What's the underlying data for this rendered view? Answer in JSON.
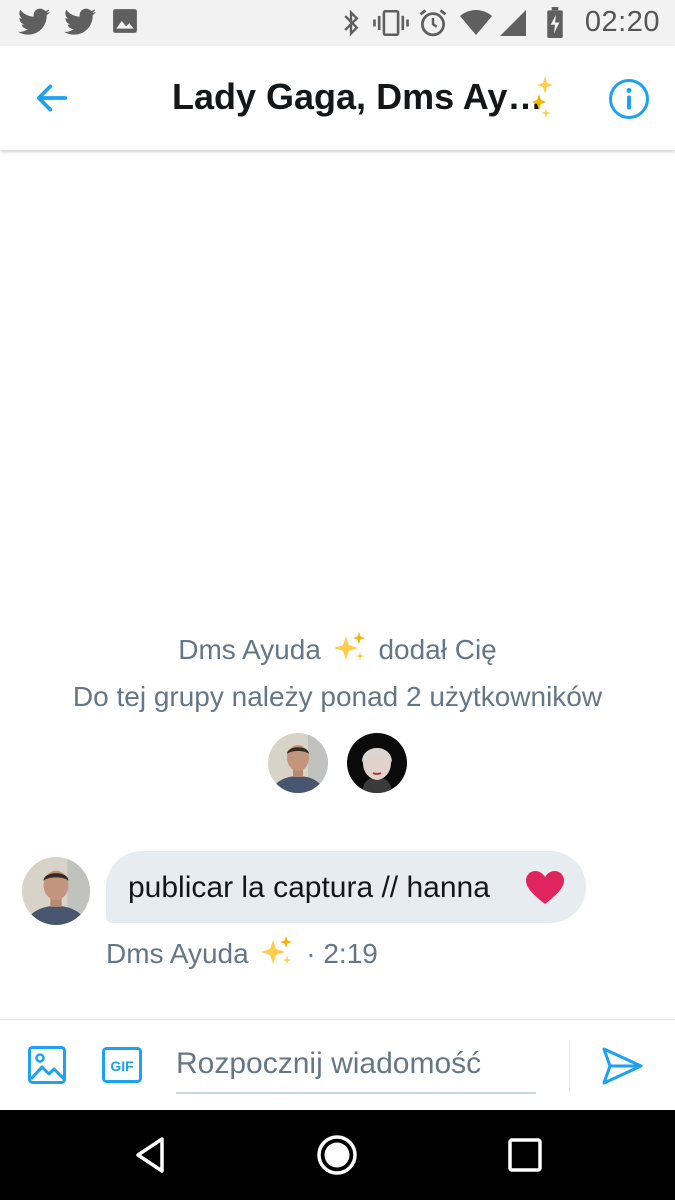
{
  "status_bar": {
    "time": "02:20",
    "left_icons": [
      "twitter-notification-icon",
      "twitter-notification-icon",
      "image-notification-icon"
    ],
    "right_icons": [
      "bluetooth-icon",
      "vibrate-icon",
      "alarm-icon",
      "wifi-icon",
      "cell-signal-icon",
      "battery-charging-icon"
    ]
  },
  "header": {
    "title": "Lady Gaga, Dms Ay…",
    "back_icon": "arrow-left-icon",
    "info_icon": "info-icon",
    "accent_color": "#1da1f2"
  },
  "conversation": {
    "system_added": {
      "prefix": "Dms Ayuda",
      "suffix": "dodał Cię"
    },
    "system_members": "Do tej grupy należy ponad 2 użytkowników",
    "messages": [
      {
        "text": "publicar la captura // hanna",
        "sender": "Dms Ayuda",
        "time": "· 2:19"
      }
    ]
  },
  "compose": {
    "placeholder": "Rozpocznij wiadomość",
    "gif_label": "GIF"
  },
  "colors": {
    "accent": "#1da1f2",
    "bubble": "#e6ecf0",
    "secondary_text": "#657786",
    "heart": "#e0245e"
  }
}
